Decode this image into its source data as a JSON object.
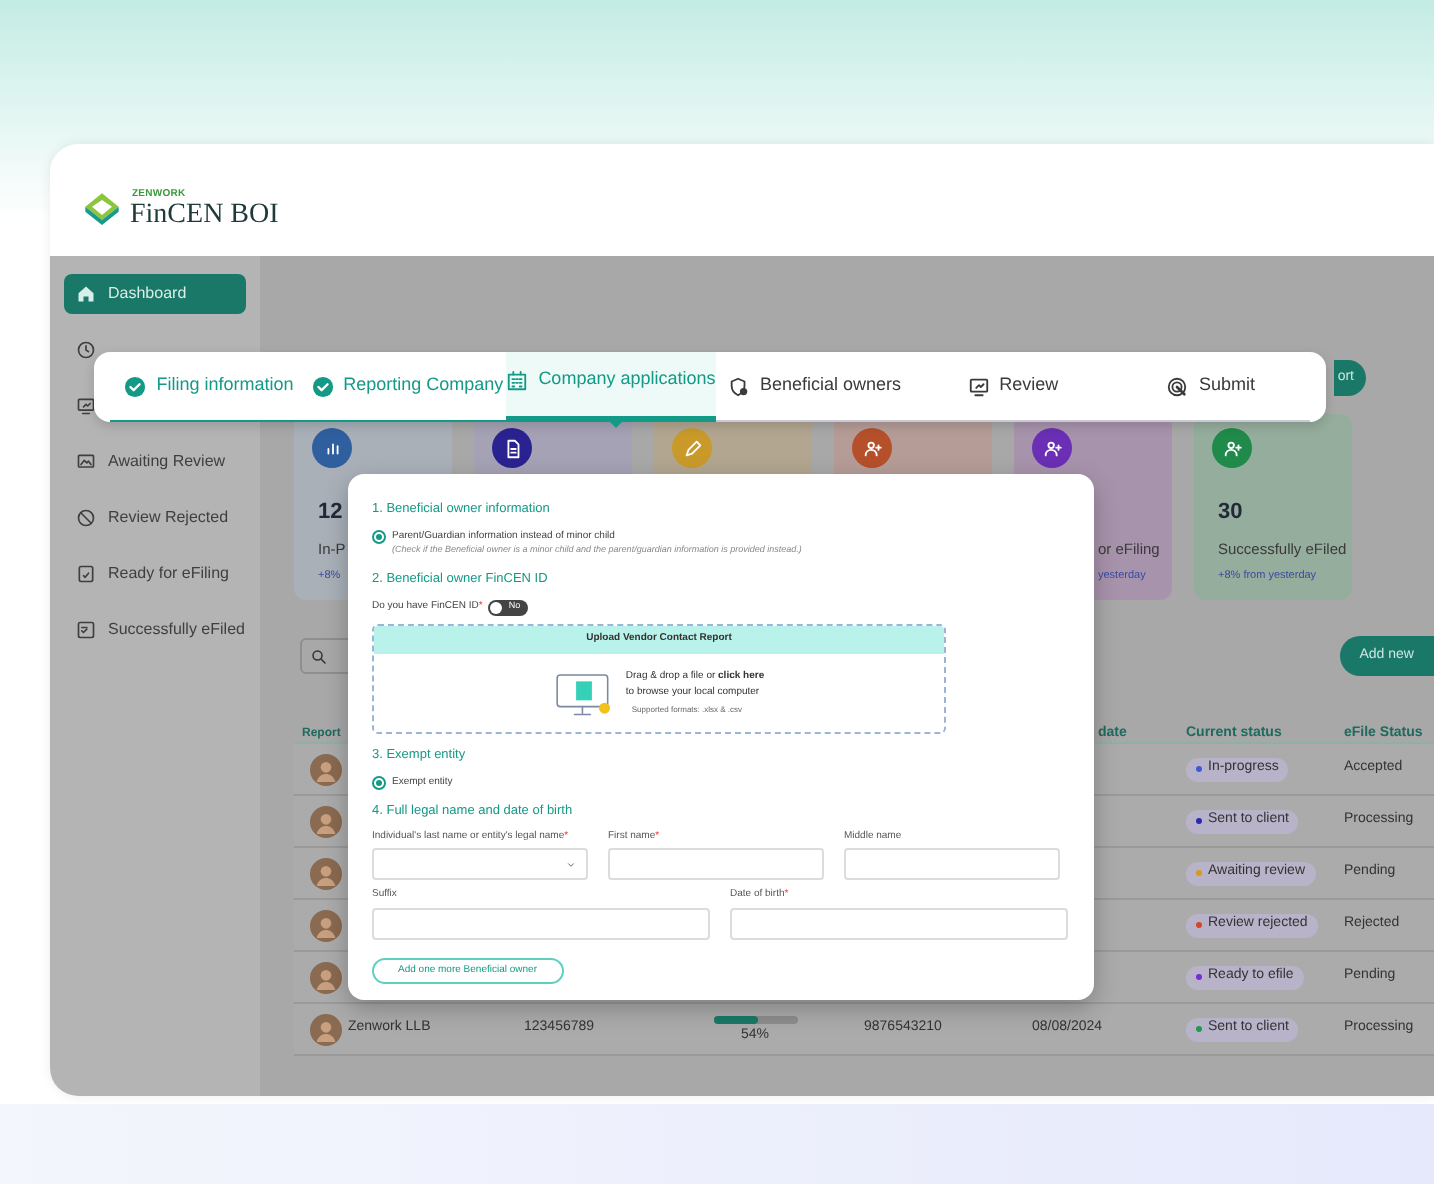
{
  "logo": {
    "brand": "ZENWORK",
    "product": "FinCEN BOI"
  },
  "sidebar": {
    "items": [
      {
        "kind": "home",
        "label": "Dashboard",
        "selected": true
      },
      {
        "kind": "clock",
        "selected": false
      },
      {
        "kind": "monitor",
        "selected": false
      },
      {
        "kind": "image",
        "label": "Awaiting Review",
        "selected": false
      },
      {
        "kind": "ban",
        "label": "Review Rejected",
        "selected": false
      },
      {
        "kind": "clipboard",
        "label": "Ready for eFiling",
        "selected": false
      },
      {
        "kind": "checklist",
        "label": "Successfully eFiled",
        "selected": false
      }
    ]
  },
  "export_button": "ort",
  "stat_cards": [
    {
      "kind": "chart",
      "color": "#2f5f9f",
      "value": "12",
      "label": "In-P",
      "delta": "+8%"
    },
    {
      "kind": "doc",
      "color": "#2a2290"
    },
    {
      "kind": "pencil",
      "color": "#c99a2a"
    },
    {
      "kind": "person",
      "color": "#b5502a"
    },
    {
      "kind": "person",
      "color": "#6a2fb5",
      "label": "or eFiling",
      "delta": "yesterday"
    },
    {
      "kind": "person",
      "color": "#1f8a4a",
      "value": "30",
      "label": "Successfully eFiled",
      "delta": "+8% from yesterday"
    }
  ],
  "add_new_button": "Add new",
  "table": {
    "columns": [
      "Report",
      "",
      "",
      "",
      "date",
      "Current status",
      "eFile Status"
    ],
    "rows": [
      {
        "status": "In-progress",
        "color": "#3b5bd6",
        "efile": "Accepted"
      },
      {
        "status": "Sent to client",
        "color": "#2a2ab0",
        "efile": "Processing"
      },
      {
        "status": "Awaiting review",
        "color": "#d99a1a",
        "efile": "Pending"
      },
      {
        "status": "Review rejected",
        "color": "#d6452a",
        "efile": "Rejected"
      },
      {
        "status": "Ready to efile",
        "color": "#7a2ad6",
        "efile": "Pending"
      },
      {
        "name": "Zenwork LLB",
        "id": "123456789",
        "level": 0.54,
        "percent": "54%",
        "phone": "9876543210",
        "date": "08/08/2024",
        "status": "Sent to client",
        "color": "#1f9a4a",
        "efile": "Processing"
      }
    ]
  },
  "stepper": [
    {
      "label": "Filing information",
      "completed": true,
      "selected": false
    },
    {
      "label": "Reporting Company",
      "completed": true,
      "selected": false
    },
    {
      "label": "Company applications",
      "kind": "building",
      "completed": false,
      "selected": true
    },
    {
      "label": "Beneficial owners",
      "kind": "shield",
      "completed": false,
      "selected": false
    },
    {
      "label": "Review",
      "kind": "monitor",
      "completed": false,
      "selected": false
    },
    {
      "label": "Submit",
      "kind": "cursor",
      "completed": false,
      "selected": false
    }
  ],
  "modal": {
    "section_1": {
      "title": "1. Beneficial owner information",
      "option": "Parent/Guardian information instead of minor child",
      "checked": true,
      "note": "(Check if the Beneficial owner is a minor child and the parent/guardian information is provided instead.)"
    },
    "section_2": {
      "title": "2. Beneficial owner FinCEN ID",
      "question": "Do you have FinCEN ID",
      "required_mark": "*",
      "toggle": {
        "on": false,
        "label": "No"
      },
      "upload": {
        "title": "Upload Vendor Contact Report",
        "line_1": "Drag & drop a file or **click here**",
        "line_2": "to browse your local computer",
        "formats": "Supported formats: .xlsx & .csv"
      }
    },
    "section_3": {
      "title": "3. Exempt entity",
      "option": "Exempt entity",
      "checked": true
    },
    "section_4": {
      "title": "4. Full legal name and date of birth",
      "rows": [
        [
          {
            "label": "Individual's last name or entity's legal name",
            "required_mark": "*",
            "kind": "select"
          },
          {
            "label": "First name",
            "required_mark": "*",
            "kind": "text"
          },
          {
            "label": "Middle name",
            "kind": "text"
          }
        ],
        [
          {
            "label": "Suffix",
            "kind": "text"
          },
          {
            "label": "Date of birth",
            "required_mark": "*",
            "kind": "text"
          }
        ]
      ]
    },
    "add_button": "Add one more Beneficial owner"
  }
}
